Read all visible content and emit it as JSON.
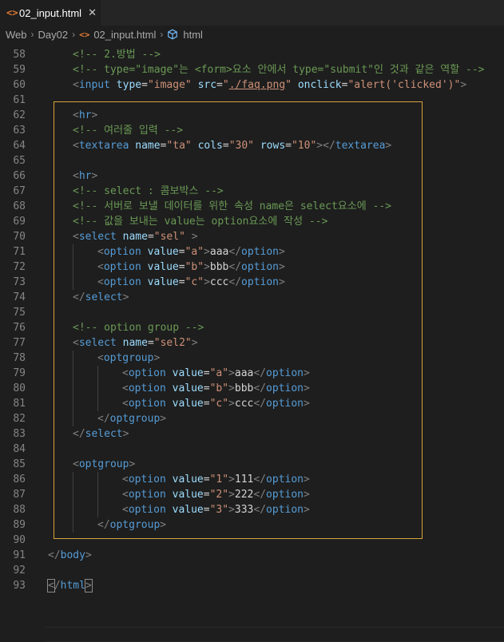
{
  "tab": {
    "icon": "<>",
    "label": "02_input.html",
    "close": "✕"
  },
  "breadcrumb": [
    "Web",
    "Day02",
    "02_input.html",
    "html"
  ],
  "breadcrumb_file_icon": "<>",
  "lines": [
    {
      "n": "58",
      "indent": 1,
      "tokens": [
        [
          "cm",
          "<!-- 2.방법 -->"
        ]
      ]
    },
    {
      "n": "59",
      "indent": 1,
      "tokens": [
        [
          "cm",
          "<!-- type=\"image\"는 <form>요소 안에서 type=\"submit\"인 것과 같은 역할 -->"
        ]
      ]
    },
    {
      "n": "60",
      "indent": 1,
      "tokens": [
        [
          "t",
          "<"
        ],
        [
          "tn",
          "input"
        ],
        [
          "tx",
          " "
        ],
        [
          "an",
          "type"
        ],
        [
          "tx",
          "="
        ],
        [
          "av",
          "\"image\""
        ],
        [
          "tx",
          " "
        ],
        [
          "an",
          "src"
        ],
        [
          "tx",
          "="
        ],
        [
          "av",
          "\""
        ],
        [
          "avu",
          "./faq.png"
        ],
        [
          "av",
          "\""
        ],
        [
          "tx",
          " "
        ],
        [
          "an",
          "onclick"
        ],
        [
          "tx",
          "="
        ],
        [
          "av",
          "\"alert('clicked')\""
        ],
        [
          "t",
          ">"
        ]
      ]
    },
    {
      "n": "61",
      "indent": 0,
      "tokens": []
    },
    {
      "n": "62",
      "indent": 1,
      "tokens": [
        [
          "t",
          "<"
        ],
        [
          "tn",
          "hr"
        ],
        [
          "t",
          ">"
        ]
      ]
    },
    {
      "n": "63",
      "indent": 1,
      "tokens": [
        [
          "cm",
          "<!-- 여러줄 입력 -->"
        ]
      ]
    },
    {
      "n": "64",
      "indent": 1,
      "tokens": [
        [
          "t",
          "<"
        ],
        [
          "tn",
          "textarea"
        ],
        [
          "tx",
          " "
        ],
        [
          "an",
          "name"
        ],
        [
          "tx",
          "="
        ],
        [
          "av",
          "\"ta\""
        ],
        [
          "tx",
          " "
        ],
        [
          "an",
          "cols"
        ],
        [
          "tx",
          "="
        ],
        [
          "av",
          "\"30\""
        ],
        [
          "tx",
          " "
        ],
        [
          "an",
          "rows"
        ],
        [
          "tx",
          "="
        ],
        [
          "av",
          "\"10\""
        ],
        [
          "t",
          "></"
        ],
        [
          "tn",
          "textarea"
        ],
        [
          "t",
          ">"
        ]
      ]
    },
    {
      "n": "65",
      "indent": 0,
      "tokens": []
    },
    {
      "n": "66",
      "indent": 1,
      "tokens": [
        [
          "t",
          "<"
        ],
        [
          "tn",
          "hr"
        ],
        [
          "t",
          ">"
        ]
      ]
    },
    {
      "n": "67",
      "indent": 1,
      "tokens": [
        [
          "cm",
          "<!-- select : 콤보박스 -->"
        ]
      ]
    },
    {
      "n": "68",
      "indent": 1,
      "tokens": [
        [
          "cm",
          "<!-- 서버로 보낼 데이터를 위한 속성 name은 select요소에 -->"
        ]
      ]
    },
    {
      "n": "69",
      "indent": 1,
      "tokens": [
        [
          "cm",
          "<!-- 값을 보내는 value는 option요소에 작성 -->"
        ]
      ]
    },
    {
      "n": "70",
      "indent": 1,
      "tokens": [
        [
          "t",
          "<"
        ],
        [
          "tn",
          "select"
        ],
        [
          "tx",
          " "
        ],
        [
          "an",
          "name"
        ],
        [
          "tx",
          "="
        ],
        [
          "av",
          "\"sel\""
        ],
        [
          "tx",
          " "
        ],
        [
          "t",
          ">"
        ]
      ]
    },
    {
      "n": "71",
      "indent": 2,
      "tokens": [
        [
          "t",
          "<"
        ],
        [
          "tn",
          "option"
        ],
        [
          "tx",
          " "
        ],
        [
          "an",
          "value"
        ],
        [
          "tx",
          "="
        ],
        [
          "av",
          "\"a\""
        ],
        [
          "t",
          ">"
        ],
        [
          "tx",
          "aaa"
        ],
        [
          "t",
          "</"
        ],
        [
          "tn",
          "option"
        ],
        [
          "t",
          ">"
        ]
      ]
    },
    {
      "n": "72",
      "indent": 2,
      "tokens": [
        [
          "t",
          "<"
        ],
        [
          "tn",
          "option"
        ],
        [
          "tx",
          " "
        ],
        [
          "an",
          "value"
        ],
        [
          "tx",
          "="
        ],
        [
          "av",
          "\"b\""
        ],
        [
          "t",
          ">"
        ],
        [
          "tx",
          "bbb"
        ],
        [
          "t",
          "</"
        ],
        [
          "tn",
          "option"
        ],
        [
          "t",
          ">"
        ]
      ]
    },
    {
      "n": "73",
      "indent": 2,
      "tokens": [
        [
          "t",
          "<"
        ],
        [
          "tn",
          "option"
        ],
        [
          "tx",
          " "
        ],
        [
          "an",
          "value"
        ],
        [
          "tx",
          "="
        ],
        [
          "av",
          "\"c\""
        ],
        [
          "t",
          ">"
        ],
        [
          "tx",
          "ccc"
        ],
        [
          "t",
          "</"
        ],
        [
          "tn",
          "option"
        ],
        [
          "t",
          ">"
        ]
      ]
    },
    {
      "n": "74",
      "indent": 1,
      "tokens": [
        [
          "t",
          "</"
        ],
        [
          "tn",
          "select"
        ],
        [
          "t",
          ">"
        ]
      ]
    },
    {
      "n": "75",
      "indent": 0,
      "tokens": []
    },
    {
      "n": "76",
      "indent": 1,
      "tokens": [
        [
          "cm",
          "<!-- option group -->"
        ]
      ]
    },
    {
      "n": "77",
      "indent": 1,
      "tokens": [
        [
          "t",
          "<"
        ],
        [
          "tn",
          "select"
        ],
        [
          "tx",
          " "
        ],
        [
          "an",
          "name"
        ],
        [
          "tx",
          "="
        ],
        [
          "av",
          "\"sel2\""
        ],
        [
          "t",
          ">"
        ]
      ]
    },
    {
      "n": "78",
      "indent": 2,
      "tokens": [
        [
          "t",
          "<"
        ],
        [
          "tn",
          "optgroup"
        ],
        [
          "t",
          ">"
        ]
      ]
    },
    {
      "n": "79",
      "indent": 3,
      "tokens": [
        [
          "t",
          "<"
        ],
        [
          "tn",
          "option"
        ],
        [
          "tx",
          " "
        ],
        [
          "an",
          "value"
        ],
        [
          "tx",
          "="
        ],
        [
          "av",
          "\"a\""
        ],
        [
          "t",
          ">"
        ],
        [
          "tx",
          "aaa"
        ],
        [
          "t",
          "</"
        ],
        [
          "tn",
          "option"
        ],
        [
          "t",
          ">"
        ]
      ]
    },
    {
      "n": "80",
      "indent": 3,
      "tokens": [
        [
          "t",
          "<"
        ],
        [
          "tn",
          "option"
        ],
        [
          "tx",
          " "
        ],
        [
          "an",
          "value"
        ],
        [
          "tx",
          "="
        ],
        [
          "av",
          "\"b\""
        ],
        [
          "t",
          ">"
        ],
        [
          "tx",
          "bbb"
        ],
        [
          "t",
          "</"
        ],
        [
          "tn",
          "option"
        ],
        [
          "t",
          ">"
        ]
      ]
    },
    {
      "n": "81",
      "indent": 3,
      "tokens": [
        [
          "t",
          "<"
        ],
        [
          "tn",
          "option"
        ],
        [
          "tx",
          " "
        ],
        [
          "an",
          "value"
        ],
        [
          "tx",
          "="
        ],
        [
          "av",
          "\"c\""
        ],
        [
          "t",
          ">"
        ],
        [
          "tx",
          "ccc"
        ],
        [
          "t",
          "</"
        ],
        [
          "tn",
          "option"
        ],
        [
          "t",
          ">"
        ]
      ]
    },
    {
      "n": "82",
      "indent": 2,
      "tokens": [
        [
          "t",
          "</"
        ],
        [
          "tn",
          "optgroup"
        ],
        [
          "t",
          ">"
        ]
      ]
    },
    {
      "n": "83",
      "indent": 1,
      "tokens": [
        [
          "t",
          "</"
        ],
        [
          "tn",
          "select"
        ],
        [
          "t",
          ">"
        ]
      ]
    },
    {
      "n": "84",
      "indent": 0,
      "tokens": []
    },
    {
      "n": "85",
      "indent": 1,
      "tokens": [
        [
          "t",
          "<"
        ],
        [
          "tn",
          "optgroup"
        ],
        [
          "t",
          ">"
        ]
      ]
    },
    {
      "n": "86",
      "indent": 3,
      "tokens": [
        [
          "t",
          "<"
        ],
        [
          "tn",
          "option"
        ],
        [
          "tx",
          " "
        ],
        [
          "an",
          "value"
        ],
        [
          "tx",
          "="
        ],
        [
          "av",
          "\"1\""
        ],
        [
          "t",
          ">"
        ],
        [
          "tx",
          "111"
        ],
        [
          "t",
          "</"
        ],
        [
          "tn",
          "option"
        ],
        [
          "t",
          ">"
        ]
      ]
    },
    {
      "n": "87",
      "indent": 3,
      "tokens": [
        [
          "t",
          "<"
        ],
        [
          "tn",
          "option"
        ],
        [
          "tx",
          " "
        ],
        [
          "an",
          "value"
        ],
        [
          "tx",
          "="
        ],
        [
          "av",
          "\"2\""
        ],
        [
          "t",
          ">"
        ],
        [
          "tx",
          "222"
        ],
        [
          "t",
          "</"
        ],
        [
          "tn",
          "option"
        ],
        [
          "t",
          ">"
        ]
      ]
    },
    {
      "n": "88",
      "indent": 3,
      "tokens": [
        [
          "t",
          "<"
        ],
        [
          "tn",
          "option"
        ],
        [
          "tx",
          " "
        ],
        [
          "an",
          "value"
        ],
        [
          "tx",
          "="
        ],
        [
          "av",
          "\"3\""
        ],
        [
          "t",
          ">"
        ],
        [
          "tx",
          "333"
        ],
        [
          "t",
          "</"
        ],
        [
          "tn",
          "option"
        ],
        [
          "t",
          ">"
        ]
      ]
    },
    {
      "n": "89",
      "indent": 2,
      "tokens": [
        [
          "t",
          "</"
        ],
        [
          "tn",
          "optgroup"
        ],
        [
          "t",
          ">"
        ]
      ]
    },
    {
      "n": "90",
      "indent": 0,
      "tokens": []
    },
    {
      "n": "91",
      "indent": 0,
      "tokens": [
        [
          "t",
          "</"
        ],
        [
          "tn",
          "body"
        ],
        [
          "t",
          ">"
        ]
      ]
    },
    {
      "n": "92",
      "indent": 0,
      "tokens": []
    },
    {
      "n": "93",
      "indent": 0,
      "tokens": [
        [
          "tb",
          "<"
        ],
        [
          "t",
          "/"
        ],
        [
          "tn",
          "html"
        ],
        [
          "tb",
          ">"
        ]
      ]
    }
  ],
  "colors": {
    "editor_bg": "#1e1e1e",
    "tag_bracket": "#808080",
    "tag_name": "#569cd6",
    "attr_name": "#9cdcfe",
    "attr_value": "#ce9178",
    "comment": "#6a9955",
    "highlight_border": "#d7a33a"
  }
}
